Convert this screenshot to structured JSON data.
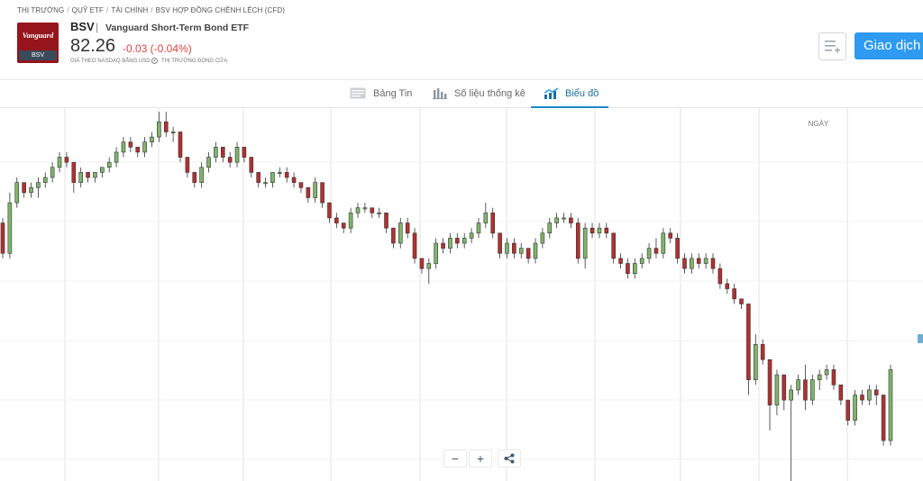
{
  "breadcrumb": [
    "THỊ TRƯỜNG",
    "QUỸ ETF",
    "TÀI CHÍNH",
    "BSV HỢP ĐỒNG CHÊNH LỆCH (CFD)"
  ],
  "instrument": {
    "logo_text": "Vanguard",
    "logo_ticker": "BSV",
    "symbol": "BSV",
    "name": "Vanguard Short-Term Bond ETF",
    "price": "82.26",
    "change": "-0.03 (-0.04%)",
    "price_note": "GIÁ THEO NASDAQ BẰNG USD",
    "market_status": "THỊ TRƯỜNG ĐÓNG CỬA"
  },
  "actions": {
    "trade_label": "Giao dịch"
  },
  "tabs": [
    {
      "label": "Bảng Tin",
      "icon": "news-icon"
    },
    {
      "label": "Số liệu thống kê",
      "icon": "stats-icon"
    },
    {
      "label": "Biểu đồ",
      "icon": "chart-icon",
      "active": true
    }
  ],
  "chart": {
    "period_label": "NGÀY",
    "zoom_out": "−",
    "zoom_in": "+",
    "share_icon": "share-icon"
  },
  "colors": {
    "up": "#7fb56b",
    "down": "#b33030",
    "accent": "#2e9af2",
    "active_tab": "#1b6e9e",
    "change": "#d64545"
  },
  "chart_data": {
    "type": "candlestick",
    "x_labels": [],
    "y_labels": [],
    "candles": [
      [
        82.52,
        82.53,
        82.45,
        82.46
      ],
      [
        82.46,
        82.58,
        82.45,
        82.56
      ],
      [
        82.56,
        82.61,
        82.55,
        82.6
      ],
      [
        82.6,
        82.6,
        82.57,
        82.58
      ],
      [
        82.58,
        82.6,
        82.57,
        82.59
      ],
      [
        82.59,
        82.61,
        82.57,
        82.6
      ],
      [
        82.6,
        82.62,
        82.59,
        82.61
      ],
      [
        82.61,
        82.64,
        82.6,
        82.63
      ],
      [
        82.63,
        82.66,
        82.62,
        82.65
      ],
      [
        82.65,
        82.66,
        82.63,
        82.64
      ],
      [
        82.64,
        82.64,
        82.58,
        82.6
      ],
      [
        82.6,
        82.63,
        82.59,
        82.62
      ],
      [
        82.62,
        82.62,
        82.6,
        82.61
      ],
      [
        82.61,
        82.62,
        82.6,
        82.62
      ],
      [
        82.62,
        82.63,
        82.61,
        82.63
      ],
      [
        82.63,
        82.65,
        82.62,
        82.64
      ],
      [
        82.64,
        82.67,
        82.63,
        82.66
      ],
      [
        82.66,
        82.69,
        82.65,
        82.68
      ],
      [
        82.68,
        82.69,
        82.66,
        82.67
      ],
      [
        82.67,
        82.67,
        82.65,
        82.66
      ],
      [
        82.66,
        82.69,
        82.65,
        82.68
      ],
      [
        82.68,
        82.7,
        82.67,
        82.69
      ],
      [
        82.69,
        82.74,
        82.68,
        82.72
      ],
      [
        82.72,
        82.74,
        82.69,
        82.7
      ],
      [
        82.7,
        82.71,
        82.68,
        82.7
      ],
      [
        82.7,
        82.7,
        82.64,
        82.65
      ],
      [
        82.65,
        82.65,
        82.61,
        82.62
      ],
      [
        82.62,
        82.62,
        82.59,
        82.6
      ],
      [
        82.6,
        82.64,
        82.59,
        82.63
      ],
      [
        82.63,
        82.66,
        82.62,
        82.65
      ],
      [
        82.65,
        82.68,
        82.64,
        82.67
      ],
      [
        82.67,
        82.67,
        82.64,
        82.65
      ],
      [
        82.65,
        82.66,
        82.63,
        82.64
      ],
      [
        82.64,
        82.68,
        82.63,
        82.67
      ],
      [
        82.67,
        82.67,
        82.64,
        82.65
      ],
      [
        82.65,
        82.65,
        82.61,
        82.62
      ],
      [
        82.62,
        82.62,
        82.59,
        82.6
      ],
      [
        82.6,
        82.61,
        82.59,
        82.6
      ],
      [
        82.6,
        82.62,
        82.59,
        82.62
      ],
      [
        82.62,
        82.63,
        82.61,
        82.62
      ],
      [
        82.62,
        82.63,
        82.6,
        82.61
      ],
      [
        82.61,
        82.62,
        82.59,
        82.6
      ],
      [
        82.6,
        82.6,
        82.58,
        82.59
      ],
      [
        82.59,
        82.59,
        82.56,
        82.57
      ],
      [
        82.57,
        82.61,
        82.56,
        82.6
      ],
      [
        82.6,
        82.6,
        82.55,
        82.56
      ],
      [
        82.56,
        82.56,
        82.52,
        82.53
      ],
      [
        82.53,
        82.54,
        82.51,
        82.52
      ],
      [
        82.52,
        82.52,
        82.5,
        82.51
      ],
      [
        82.51,
        82.55,
        82.5,
        82.54
      ],
      [
        82.54,
        82.56,
        82.53,
        82.55
      ],
      [
        82.55,
        82.56,
        82.54,
        82.55
      ],
      [
        82.55,
        82.55,
        82.53,
        82.54
      ],
      [
        82.54,
        82.55,
        82.53,
        82.54
      ],
      [
        82.54,
        82.54,
        82.5,
        82.51
      ],
      [
        82.51,
        82.51,
        82.47,
        82.48
      ],
      [
        82.48,
        82.53,
        82.47,
        82.52
      ],
      [
        82.52,
        82.53,
        82.49,
        82.5
      ],
      [
        82.5,
        82.51,
        82.44,
        82.45
      ],
      [
        82.45,
        82.45,
        82.42,
        82.43
      ],
      [
        82.43,
        82.45,
        82.4,
        82.44
      ],
      [
        82.44,
        82.49,
        82.43,
        82.48
      ],
      [
        82.48,
        82.49,
        82.46,
        82.47
      ],
      [
        82.47,
        82.5,
        82.46,
        82.49
      ],
      [
        82.49,
        82.5,
        82.47,
        82.48
      ],
      [
        82.48,
        82.5,
        82.47,
        82.49
      ],
      [
        82.49,
        82.51,
        82.48,
        82.5
      ],
      [
        82.5,
        82.53,
        82.49,
        82.52
      ],
      [
        82.52,
        82.56,
        82.51,
        82.54
      ],
      [
        82.54,
        82.55,
        82.49,
        82.5
      ],
      [
        82.5,
        82.5,
        82.45,
        82.46
      ],
      [
        82.46,
        82.49,
        82.45,
        82.48
      ],
      [
        82.48,
        82.49,
        82.45,
        82.46
      ],
      [
        82.46,
        82.48,
        82.45,
        82.47
      ],
      [
        82.47,
        82.47,
        82.44,
        82.45
      ],
      [
        82.45,
        82.49,
        82.44,
        82.48
      ],
      [
        82.48,
        82.51,
        82.47,
        82.5
      ],
      [
        82.5,
        82.53,
        82.49,
        82.52
      ],
      [
        82.52,
        82.54,
        82.51,
        82.53
      ],
      [
        82.53,
        82.54,
        82.52,
        82.53
      ],
      [
        82.53,
        82.54,
        82.51,
        82.52
      ],
      [
        82.52,
        82.53,
        82.44,
        82.45
      ],
      [
        82.45,
        82.52,
        82.43,
        82.51
      ],
      [
        82.51,
        82.52,
        82.49,
        82.5
      ],
      [
        82.5,
        82.52,
        82.49,
        82.51
      ],
      [
        82.51,
        82.52,
        82.49,
        82.5
      ],
      [
        82.5,
        82.5,
        82.44,
        82.45
      ],
      [
        82.45,
        82.46,
        82.43,
        82.44
      ],
      [
        82.44,
        82.45,
        82.41,
        82.42
      ],
      [
        82.42,
        82.45,
        82.41,
        82.44
      ],
      [
        82.44,
        82.46,
        82.43,
        82.45
      ],
      [
        82.45,
        82.48,
        82.44,
        82.47
      ],
      [
        82.47,
        82.49,
        82.45,
        82.46
      ],
      [
        82.46,
        82.51,
        82.45,
        82.5
      ],
      [
        82.5,
        82.51,
        82.48,
        82.49
      ],
      [
        82.49,
        82.5,
        82.44,
        82.45
      ],
      [
        82.45,
        82.46,
        82.42,
        82.43
      ],
      [
        82.43,
        82.46,
        82.42,
        82.45
      ],
      [
        82.45,
        82.46,
        82.43,
        82.44
      ],
      [
        82.44,
        82.46,
        82.43,
        82.45
      ],
      [
        82.45,
        82.46,
        82.42,
        82.43
      ],
      [
        82.43,
        82.44,
        82.39,
        82.4
      ],
      [
        82.4,
        82.41,
        82.38,
        82.39
      ],
      [
        82.39,
        82.4,
        82.36,
        82.37
      ],
      [
        82.37,
        82.37,
        82.35,
        82.36
      ],
      [
        82.36,
        82.36,
        82.18,
        82.21
      ],
      [
        82.21,
        82.3,
        82.2,
        82.28
      ],
      [
        82.28,
        82.29,
        82.24,
        82.25
      ],
      [
        82.25,
        82.25,
        82.11,
        82.16
      ],
      [
        82.16,
        82.23,
        82.14,
        82.22
      ],
      [
        82.22,
        82.22,
        82.15,
        82.17
      ],
      [
        82.17,
        82.2,
        82.01,
        82.19
      ],
      [
        82.19,
        82.22,
        82.18,
        82.21
      ],
      [
        82.21,
        82.24,
        82.15,
        82.17
      ],
      [
        82.17,
        82.22,
        82.16,
        82.21
      ],
      [
        82.21,
        82.23,
        82.19,
        82.22
      ],
      [
        82.22,
        82.24,
        82.21,
        82.23
      ],
      [
        82.23,
        82.24,
        82.19,
        82.2
      ],
      [
        82.2,
        82.2,
        82.16,
        82.17
      ],
      [
        82.17,
        82.17,
        82.12,
        82.13
      ],
      [
        82.13,
        82.19,
        82.12,
        82.18
      ],
      [
        82.18,
        82.19,
        82.16,
        82.17
      ],
      [
        82.17,
        82.2,
        82.16,
        82.19
      ],
      [
        82.19,
        82.2,
        82.16,
        82.18
      ],
      [
        82.18,
        82.18,
        82.08,
        82.09
      ],
      [
        82.09,
        82.24,
        82.08,
        82.23
      ]
    ]
  }
}
